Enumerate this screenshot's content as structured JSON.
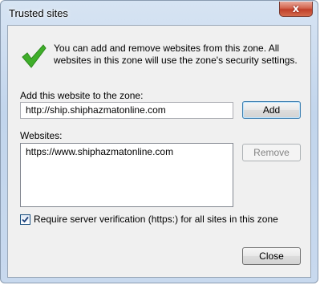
{
  "window": {
    "title": "Trusted sites",
    "close_glyph": "x"
  },
  "info": {
    "icon": "green-check-icon",
    "text": "You can add and remove websites from this zone. All websites in this zone will use the zone's security settings."
  },
  "add_site": {
    "label": "Add this website to the zone:",
    "value": "http://ship.shiphazmatonline.com",
    "add_button": "Add"
  },
  "websites": {
    "label": "Websites:",
    "items": [
      "https://www.shiphazmatonline.com"
    ],
    "remove_button": "Remove"
  },
  "require_https": {
    "checked": true,
    "label": "Require server verification (https:) for all sites in this zone"
  },
  "footer": {
    "close_button": "Close"
  },
  "colors": {
    "check_green": "#3fae2a",
    "title_bar": "#c9daee",
    "close_button_red": "#c9442e"
  }
}
